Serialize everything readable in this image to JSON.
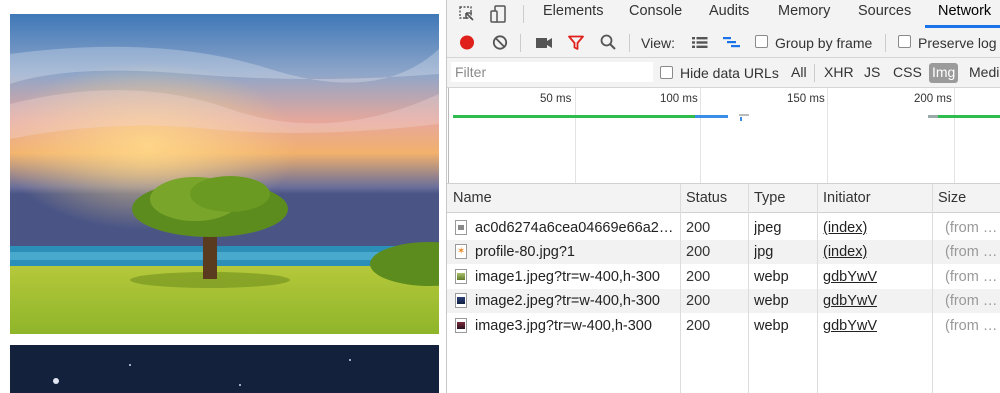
{
  "devtools": {
    "tabs": [
      {
        "label": "Elements"
      },
      {
        "label": "Console"
      },
      {
        "label": "Audits"
      },
      {
        "label": "Memory"
      },
      {
        "label": "Sources"
      },
      {
        "label": "Network",
        "active": true
      }
    ],
    "toolbar": {
      "view_label": "View:",
      "group_by_frame_label": "Group by frame",
      "preserve_log_label": "Preserve log",
      "record_color": "#e0201b",
      "filter_icon_color": "#e0201b"
    },
    "filter_bar": {
      "placeholder": "Filter",
      "hide_data_urls_label": "Hide data URLs",
      "types": [
        "All",
        "XHR",
        "JS",
        "CSS",
        "Img",
        "Medi"
      ],
      "active_type": "Img"
    },
    "overview": {
      "ticks": [
        "50 ms",
        "100 ms",
        "150 ms",
        "200 ms"
      ]
    },
    "table": {
      "headers": {
        "name": "Name",
        "status": "Status",
        "type": "Type",
        "initiator": "Initiator",
        "size": "Size"
      },
      "rows": [
        {
          "name": "ac0d6274a6cea04669e66a2…",
          "status": "200",
          "type": "jpeg",
          "initiator": "(index)",
          "size": "(from …",
          "icon": "image-file-icon"
        },
        {
          "name": "profile-80.jpg?1",
          "status": "200",
          "type": "jpg",
          "initiator": "(index)",
          "size": "(from …",
          "icon": "image-file-icon"
        },
        {
          "name": "image1.jpeg?tr=w-400,h-300",
          "status": "200",
          "type": "webp",
          "initiator": "gdbYwV",
          "size": "(from …",
          "icon": "image-file-icon"
        },
        {
          "name": "image2.jpeg?tr=w-400,h-300",
          "status": "200",
          "type": "webp",
          "initiator": "gdbYwV",
          "size": "(from …",
          "icon": "image-file-icon"
        },
        {
          "name": "image3.jpg?tr=w-400,h-300",
          "status": "200",
          "type": "webp",
          "initiator": "gdbYwV",
          "size": "(from …",
          "icon": "image-file-icon"
        }
      ]
    }
  }
}
